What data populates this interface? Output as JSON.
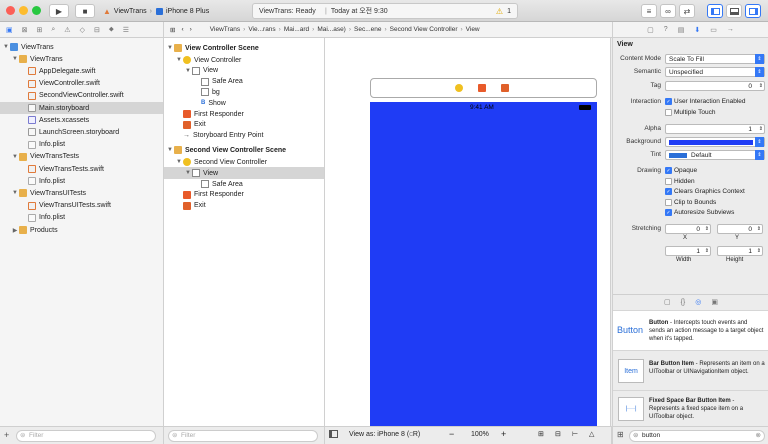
{
  "toolbar": {
    "scheme_name": "ViewTrans",
    "device_name": "iPhone 8 Plus",
    "status_text": "ViewTrans: Ready",
    "status_time": "Today at 오전 9:30",
    "warning_count": "1"
  },
  "jump_bar": [
    "ViewTrans",
    "Vie...rans",
    "Mai...ard",
    "Mai...ase)",
    "Sec...ene",
    "Second View Controller",
    "View"
  ],
  "navigator": {
    "items": [
      {
        "label": "ViewTrans",
        "kind": "project",
        "level": 0,
        "expanded": true
      },
      {
        "label": "ViewTrans",
        "kind": "folder",
        "level": 1,
        "expanded": true
      },
      {
        "label": "AppDelegate.swift",
        "kind": "swift",
        "level": 2
      },
      {
        "label": "ViewController.swift",
        "kind": "swift",
        "level": 2
      },
      {
        "label": "SecondViewController.swift",
        "kind": "swift",
        "level": 2
      },
      {
        "label": "Main.storyboard",
        "kind": "storyboard",
        "level": 2,
        "selected": true
      },
      {
        "label": "Assets.xcassets",
        "kind": "assets",
        "level": 2
      },
      {
        "label": "LaunchScreen.storyboard",
        "kind": "storyboard",
        "level": 2
      },
      {
        "label": "Info.plist",
        "kind": "plist",
        "level": 2
      },
      {
        "label": "ViewTransTests",
        "kind": "folder",
        "level": 1,
        "expanded": true
      },
      {
        "label": "ViewTransTests.swift",
        "kind": "swift",
        "level": 2
      },
      {
        "label": "Info.plist",
        "kind": "plist",
        "level": 2
      },
      {
        "label": "ViewTransUITests",
        "kind": "folder",
        "level": 1,
        "expanded": true
      },
      {
        "label": "ViewTransUITests.swift",
        "kind": "swift",
        "level": 2
      },
      {
        "label": "Info.plist",
        "kind": "plist",
        "level": 2
      },
      {
        "label": "Products",
        "kind": "folder",
        "level": 1,
        "expanded": false
      }
    ],
    "filter_placeholder": "Filter"
  },
  "outline": {
    "scene1_title": "View Controller Scene",
    "scene1": [
      {
        "label": "View Controller",
        "kind": "vc",
        "level": 1
      },
      {
        "label": "View",
        "kind": "view",
        "level": 2
      },
      {
        "label": "Safe Area",
        "kind": "safe",
        "level": 3
      },
      {
        "label": "bg",
        "kind": "img",
        "level": 3
      },
      {
        "label": "Show",
        "kind": "btn",
        "level": 3
      },
      {
        "label": "First Responder",
        "kind": "fr",
        "level": 1
      },
      {
        "label": "Exit",
        "kind": "exit",
        "level": 1
      },
      {
        "label": "Storyboard Entry Point",
        "kind": "entry",
        "level": 1
      }
    ],
    "scene2_title": "Second View Controller Scene",
    "scene2": [
      {
        "label": "Second View Controller",
        "kind": "vc",
        "level": 1
      },
      {
        "label": "View",
        "kind": "view",
        "level": 2,
        "selected": true
      },
      {
        "label": "Safe Area",
        "kind": "safe",
        "level": 3
      },
      {
        "label": "First Responder",
        "kind": "fr",
        "level": 1
      },
      {
        "label": "Exit",
        "kind": "exit",
        "level": 1
      }
    ],
    "filter_placeholder": "Filter"
  },
  "canvas": {
    "status_bar_time": "9:41 AM",
    "view_as": "View as: iPhone 8 (",
    "view_as_suffix": "C",
    "view_as_end": "R)",
    "zoom": "100%",
    "view_color": "#1f3cf5"
  },
  "inspector": {
    "section_title": "View",
    "content_mode_label": "Content Mode",
    "content_mode_value": "Scale To Fill",
    "semantic_label": "Semantic",
    "semantic_value": "Unspecified",
    "tag_label": "Tag",
    "tag_value": "0",
    "interaction_label": "Interaction",
    "user_interaction": "User Interaction Enabled",
    "multiple_touch": "Multiple Touch",
    "alpha_label": "Alpha",
    "alpha_value": "1",
    "background_label": "Background",
    "tint_label": "Tint",
    "tint_value": "Default",
    "drawing_label": "Drawing",
    "opaque": "Opaque",
    "hidden": "Hidden",
    "clears_graphics": "Clears Graphics Context",
    "clip_to_bounds": "Clip to Bounds",
    "autoresize": "Autoresize Subviews",
    "stretching_label": "Stretching",
    "stretch_x": "0",
    "stretch_y": "0",
    "stretch_w": "1",
    "stretch_h": "1",
    "x_label": "X",
    "y_label": "Y",
    "width_label": "Width",
    "height_label": "Height"
  },
  "library": {
    "items": [
      {
        "icon_text": "Button",
        "title": "Button",
        "desc": " - Intercepts touch events and sends an action message to a target object when it's tapped."
      },
      {
        "icon_text": "Item",
        "title": "Bar Button Item",
        "desc": " - Represents an item on a UIToolbar or UINavigationItem object."
      },
      {
        "icon_text": "",
        "title": "Fixed Space Bar Button Item",
        "desc": " - Represents a fixed space item on a UIToolbar object."
      }
    ],
    "search_value": "button"
  }
}
